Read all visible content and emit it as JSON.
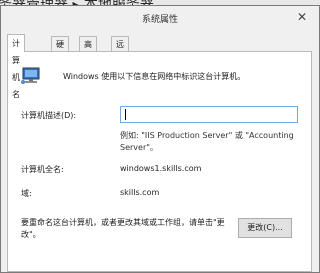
{
  "background": {
    "title": "务器管理器 ▸ 本地服务器"
  },
  "dialog": {
    "title": "系统属性",
    "close_glyph": "✕",
    "tabs": [
      {
        "label": "计算机名",
        "active": true
      },
      {
        "label": "硬件",
        "active": false
      },
      {
        "label": "高级",
        "active": false
      },
      {
        "label": "远程",
        "active": false
      }
    ],
    "intro_text": "Windows 使用以下信息在网络中标识这台计算机。",
    "description_label": "计算机描述(D):",
    "description_value": "",
    "example_text": "例如: \"IIS Production Server\" 或 \"Accounting Server\"。",
    "full_name_label": "计算机全名:",
    "full_name_value": "windows1.skills.com",
    "domain_label": "域:",
    "domain_value": "skills.com",
    "rename_text": "要重命名这台计算机，或者更改其域或工作组，请单击\"更改\"。",
    "change_button": "更改(C)..."
  },
  "colors": {
    "dialog_bg": "#f0f0f0",
    "panel_bg": "#ffffff",
    "input_border": "#7aa7d8",
    "icon_screen": "#2f73c9"
  }
}
